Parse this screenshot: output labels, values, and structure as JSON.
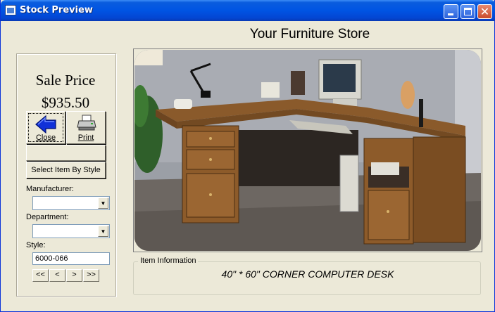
{
  "window": {
    "title": "Stock Preview",
    "icon": "app-window-icon",
    "controls": [
      "minimize-icon",
      "maximize-icon",
      "close-icon"
    ]
  },
  "store": {
    "title": "Your Furniture Store"
  },
  "pricing": {
    "label": "Sale Price",
    "value": "$935.50"
  },
  "toolbar": {
    "close_label": "Close",
    "close_icon": "back-arrow-icon",
    "print_label": "Print",
    "print_icon": "printer-icon",
    "select_by_style_label": "Select Item By Style"
  },
  "filters": {
    "manufacturer": {
      "label": "Manufacturer:",
      "value": ""
    },
    "department": {
      "label": "Department:",
      "value": ""
    },
    "style": {
      "label": "Style:",
      "value": "6000-066"
    }
  },
  "navigation": {
    "first": "<<",
    "prev": "<",
    "next": ">",
    "last": ">>"
  },
  "item": {
    "section_label": "Item Information",
    "description": "40\" * 60\" CORNER COMPUTER DESK"
  },
  "colors": {
    "window_bg": "#ece9d8",
    "titlebar": "#0054e3",
    "arrow": "#1030d8"
  }
}
